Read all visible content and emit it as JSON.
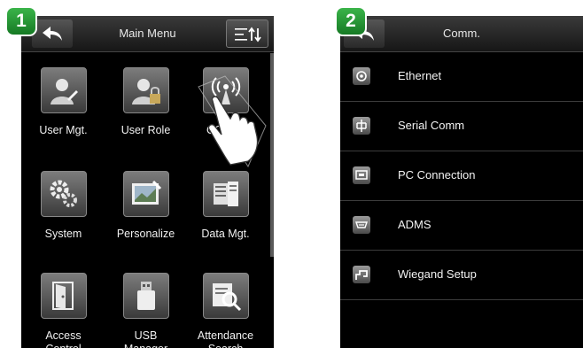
{
  "panel1": {
    "step": "1",
    "title": "Main Menu",
    "tiles": [
      {
        "label": "User Mgt.",
        "icon": "user-mgt-icon"
      },
      {
        "label": "User Role",
        "icon": "user-role-icon"
      },
      {
        "label": "COMM.",
        "icon": "comm-icon"
      },
      {
        "label": "System",
        "icon": "system-gears-icon"
      },
      {
        "label": "Personalize",
        "icon": "personalize-icon"
      },
      {
        "label": "Data Mgt.",
        "icon": "data-mgt-icon"
      },
      {
        "label": "Access\nControl",
        "icon": "access-control-door-icon"
      },
      {
        "label": "USB\nManager",
        "icon": "usb-icon"
      },
      {
        "label": "Attendance\nSearch",
        "icon": "attendance-search-icon"
      }
    ]
  },
  "panel2": {
    "step": "2",
    "title": "Comm.",
    "items": [
      {
        "label": "Ethernet",
        "icon": "ethernet-icon"
      },
      {
        "label": "Serial Comm",
        "icon": "serial-comm-icon"
      },
      {
        "label": "PC Connection",
        "icon": "pc-connection-icon"
      },
      {
        "label": "ADMS",
        "icon": "adms-icon"
      },
      {
        "label": "Wiegand Setup",
        "icon": "wiegand-icon"
      }
    ]
  },
  "colors": {
    "badge": "#2a9a38",
    "screen": "#000000",
    "bar": "#2a2a2a"
  }
}
